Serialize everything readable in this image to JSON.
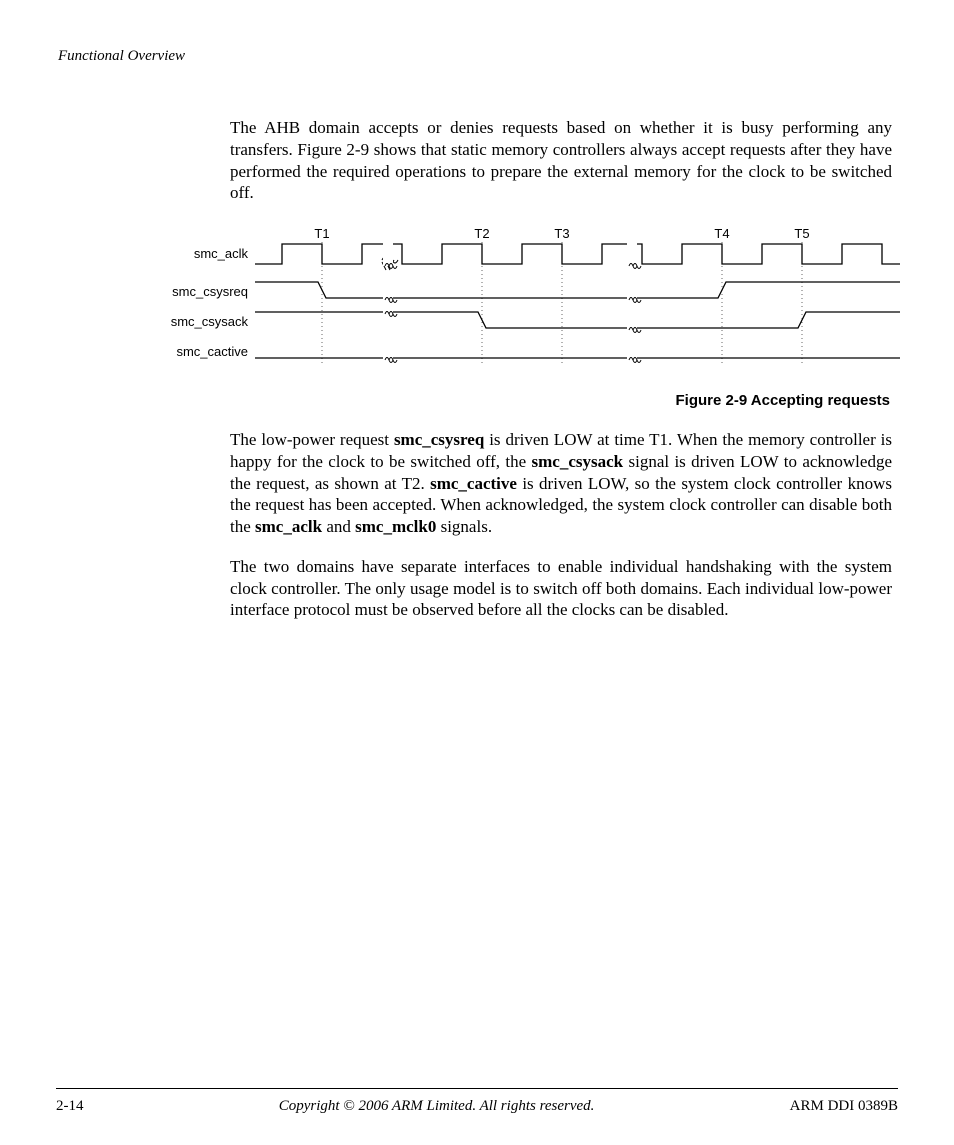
{
  "header": {
    "section": "Functional Overview"
  },
  "p1": "The AHB domain accepts or denies requests based on whether it is busy performing any transfers. Figure 2-9 shows that static memory controllers always accept requests after they have performed the required operations to prepare the external memory for the clock to be switched off.",
  "figure": {
    "caption": "Figure 2-9 Accepting requests",
    "time_labels": [
      "T1",
      "T2",
      "T3",
      "T4",
      "T5"
    ],
    "signals": [
      "smc_aclk",
      "smc_csysreq",
      "smc_csysack",
      "smc_cactive"
    ]
  },
  "p2": {
    "a": "The low-power request ",
    "b1": "smc_csysreq",
    "c": " is driven LOW at time T1. When the memory controller is happy for the clock to be switched off, the ",
    "b2": "smc_csysack",
    "d": " signal is driven LOW to acknowledge the request, as shown at T2. ",
    "b3": "smc_cactive",
    "e": " is driven LOW, so the system clock controller knows the request has been accepted. When acknowledged, the system clock controller can disable both the ",
    "b4": "smc_aclk",
    "f": " and ",
    "b5": "smc_mclk0",
    "g": " signals."
  },
  "p3": "The two domains have separate interfaces to enable individual handshaking with the system clock controller. The only usage model is to switch off both domains. Each individual low-power interface protocol must be observed before all the clocks can be disabled.",
  "footer": {
    "page": "2-14",
    "copyright": "Copyright © 2006 ARM Limited. All rights reserved.",
    "doc": "ARM DDI 0389B"
  }
}
